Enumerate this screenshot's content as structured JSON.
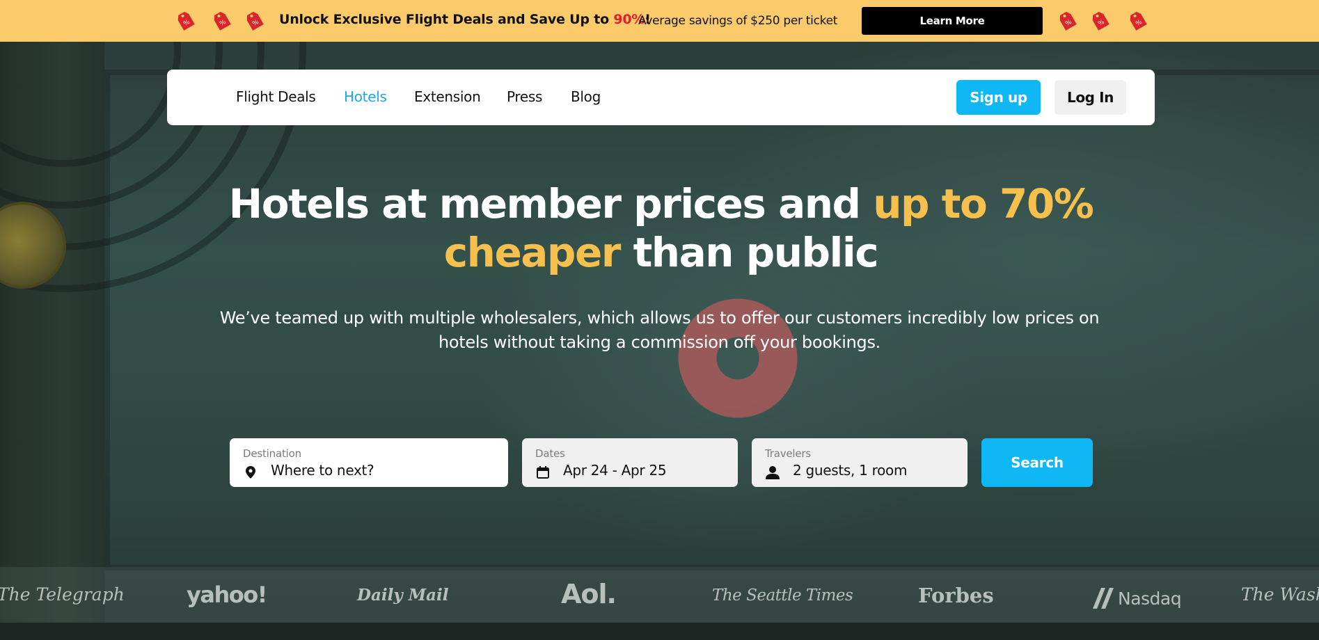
{
  "promo": {
    "headline_before": "Unlock Exclusive Flight Deals and Save Up to ",
    "headline_percent": "90%",
    "headline_after": "!",
    "subtext": "Average savings of $250 per ticket",
    "button_label": "Learn More",
    "tag_icon": "discount-tag-icon"
  },
  "nav": {
    "links": [
      "Flight Deals",
      "Hotels",
      "Extension",
      "Press",
      "Blog"
    ],
    "active": "Hotels",
    "signup_label": "Sign up",
    "login_label": "Log In"
  },
  "hero": {
    "title_line1_white": "Hotels at member prices and ",
    "title_line1_highlight": "up to 70%",
    "title_line2_highlight": "cheaper",
    "title_line2_white": " than public",
    "subtitle": "We’ve teamed up with multiple wholesalers, which allows us to offer our customers incredibly low prices on hotels without taking a commission off your bookings."
  },
  "search": {
    "destination_label": "Destination",
    "destination_placeholder": "Where to next?",
    "dates_label": "Dates",
    "dates_value": "Apr 24 - Apr 25",
    "travelers_label": "Travelers",
    "travelers_value": "2 guests, 1 room",
    "button_label": "Search"
  },
  "press_logos": [
    "The Telegraph",
    "yahoo!",
    "Daily Mail",
    "Aol.",
    "The Seattle Times",
    "Forbes",
    "Nasdaq",
    "The Washin"
  ],
  "colors": {
    "promo_bg": "#fbcb6b",
    "accent_blue": "#0fb7f5",
    "highlight_yellow": "#f5c04e",
    "promo_red": "#e5202a"
  }
}
